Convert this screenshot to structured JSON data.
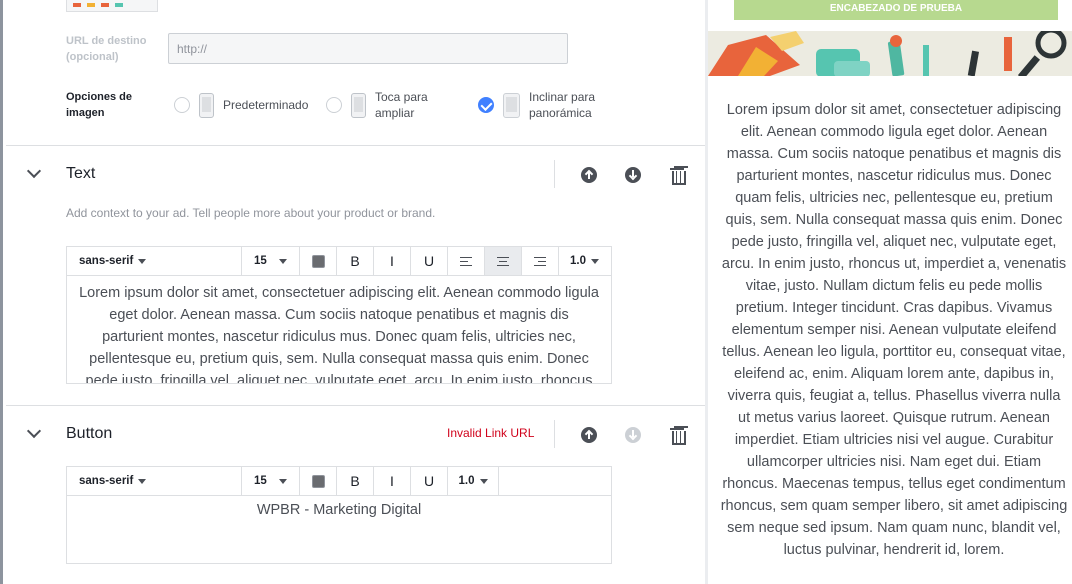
{
  "image_options": {
    "url_label": "URL de destino (opcional)",
    "url_placeholder": "http://",
    "options_label": "Opciones de imagen",
    "options": [
      {
        "label": "Predeterminado",
        "selected": false
      },
      {
        "label": "Toca para ampliar",
        "selected": false
      },
      {
        "label": "Inclinar para panorámica",
        "selected": true
      }
    ]
  },
  "text_section": {
    "title": "Text",
    "help": "Add context to your ad. Tell people more about your product or brand.",
    "toolbar": {
      "font": "sans-serif",
      "size": "15",
      "bold": "B",
      "italic": "I",
      "underline": "U",
      "line_spacing": "1.0",
      "alignment": "center"
    },
    "content": "Lorem ipsum dolor sit amet, consectetuer adipiscing elit. Aenean commodo ligula eget dolor. Aenean massa. Cum sociis natoque penatibus et magnis dis parturient montes, nascetur ridiculus mus. Donec quam felis, ultricies nec, pellentesque eu, pretium quis, sem. Nulla consequat massa quis enim. Donec pede justo, fringilla vel, aliquet nec, vulputate eget, arcu. In enim justo, rhoncus"
  },
  "button_section": {
    "title": "Button",
    "error": "Invalid Link URL",
    "toolbar": {
      "font": "sans-serif",
      "size": "15",
      "bold": "B",
      "italic": "I",
      "underline": "U",
      "line_spacing": "1.0"
    },
    "content": "WPBR - Marketing Digital"
  },
  "preview": {
    "header": "ENCABEZADO DE PRUEBA",
    "body": "Lorem ipsum dolor sit amet, consectetuer adipiscing elit. Aenean commodo ligula eget dolor. Aenean massa. Cum sociis natoque penatibus et magnis dis parturient montes, nascetur ridiculus mus. Donec quam felis, ultricies nec, pellentesque eu, pretium quis, sem. Nulla consequat massa quis enim. Donec pede justo, fringilla vel, aliquet nec, vulputate eget, arcu. In enim justo, rhoncus ut, imperdiet a, venenatis vitae, justo. Nullam dictum felis eu pede mollis pretium. Integer tincidunt. Cras dapibus. Vivamus elementum semper nisi. Aenean vulputate eleifend tellus. Aenean leo ligula, porttitor eu, consequat vitae, eleifend ac, enim. Aliquam lorem ante, dapibus in, viverra quis, feugiat a, tellus. Phasellus viverra nulla ut metus varius laoreet. Quisque rutrum. Aenean imperdiet. Etiam ultricies nisi vel augue. Curabitur ullamcorper ultricies nisi. Nam eget dui. Etiam rhoncus. Maecenas tempus, tellus eget condimentum rhoncus, sem quam semper libero, sit amet adipiscing sem neque sed ipsum. Nam quam nunc, blandit vel, luctus pulvinar, hendrerit id, lorem."
  },
  "colors": {
    "accent": "#4080ff",
    "error": "#d0021b",
    "preview_header": "#b7d98f"
  }
}
